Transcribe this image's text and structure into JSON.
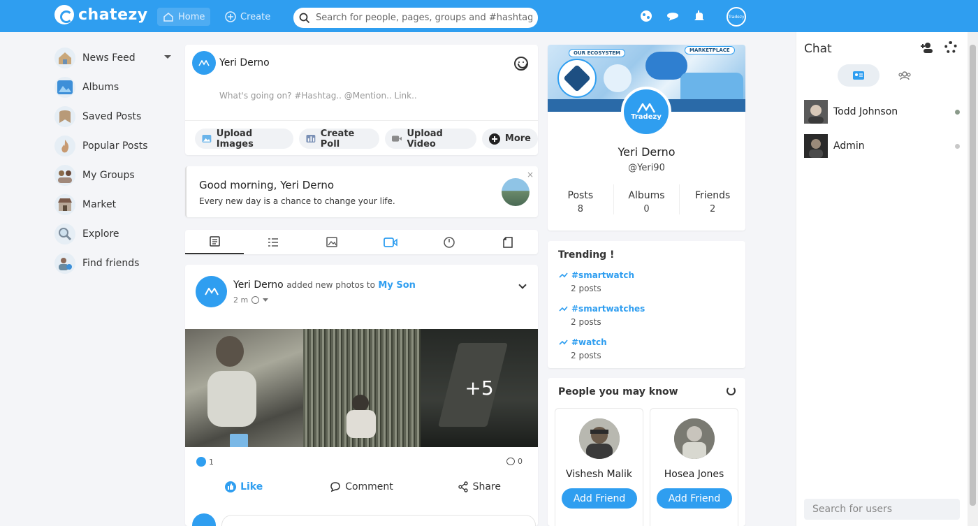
{
  "brand": {
    "name": "chatezy",
    "color": "#2f9ef0"
  },
  "nav": {
    "home": "Home",
    "create": "Create",
    "search_placeholder": "Search for people, pages, groups and #hashtags"
  },
  "sidebar": {
    "items": [
      {
        "label": "News Feed",
        "icon": "news-feed-icon"
      },
      {
        "label": "Albums",
        "icon": "albums-icon"
      },
      {
        "label": "Saved Posts",
        "icon": "saved-posts-icon"
      },
      {
        "label": "Popular Posts",
        "icon": "popular-posts-icon"
      },
      {
        "label": "My Groups",
        "icon": "groups-icon"
      },
      {
        "label": "Market",
        "icon": "market-icon"
      },
      {
        "label": "Explore",
        "icon": "explore-icon"
      },
      {
        "label": "Find friends",
        "icon": "find-friends-icon"
      }
    ]
  },
  "composer": {
    "user": "Yeri Derno",
    "placeholder": "What's going on? #Hashtag.. @Mention.. Link..",
    "actions": {
      "upload_images": "Upload Images",
      "create_poll": "Create Poll",
      "upload_video": "Upload Video",
      "more": "More"
    }
  },
  "greeting": {
    "title": "Good morning, Yeri Derno",
    "subtitle": "Every new day is a chance to change your life.",
    "close": "×"
  },
  "post": {
    "author": "Yeri Derno",
    "action": "added new photos to",
    "album": "My Son",
    "time": "2 m",
    "extra_photos": "+5",
    "likes": "1",
    "comments": "0",
    "actions": {
      "like": "Like",
      "comment": "Comment",
      "share": "Share"
    }
  },
  "profile": {
    "cover_labels": {
      "ecosystem": "OUR ECOSYSTEM",
      "marketplace": "MARKETPLACE"
    },
    "avatar_text": "Tradezy",
    "name": "Yeri Derno",
    "handle": "@Yeri90",
    "stats": {
      "posts_label": "Posts",
      "posts": "8",
      "albums_label": "Albums",
      "albums": "0",
      "friends_label": "Friends",
      "friends": "2"
    }
  },
  "trending": {
    "title": "Trending !",
    "items": [
      {
        "tag": "#smartwatch",
        "count": "2 posts"
      },
      {
        "tag": "#smartwatches",
        "count": "2 posts"
      },
      {
        "tag": "#watch",
        "count": "2 posts"
      }
    ]
  },
  "people": {
    "title": "People you may know",
    "items": [
      {
        "name": "Vishesh Malik",
        "button": "Add Friend"
      },
      {
        "name": "Hosea Jones",
        "button": "Add Friend"
      }
    ]
  },
  "chat": {
    "title": "Chat",
    "users": [
      {
        "name": "Todd Johnson",
        "status_color": "#8a9a8a"
      },
      {
        "name": "Admin",
        "status_color": "#c8c8c8"
      }
    ],
    "search_placeholder": "Search for users"
  }
}
